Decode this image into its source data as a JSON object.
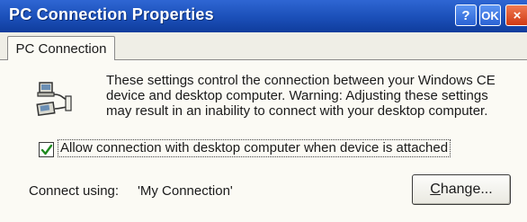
{
  "window": {
    "title": "PC Connection Properties",
    "help_button": "?",
    "ok_button": "OK",
    "close_button": "×"
  },
  "tabs": [
    {
      "label": "PC Connection",
      "selected": true
    }
  ],
  "content": {
    "icon": "pc-connection-icon",
    "description": "These settings control the connection between your Windows CE device and desktop computer.  Warning: Adjusting these settings may result in an inability to connect with your desktop computer.",
    "checkbox": {
      "label": "Allow connection with desktop computer when device is attached",
      "checked": true
    },
    "connect_using_label": "Connect using:",
    "connect_using_value": "'My Connection'",
    "change_button": "Change..."
  },
  "colors": {
    "titlebar": "#1b4fb8",
    "background": "#fbfaf4",
    "close_button": "#cf3a14",
    "check_mark": "#1f8a1f"
  }
}
